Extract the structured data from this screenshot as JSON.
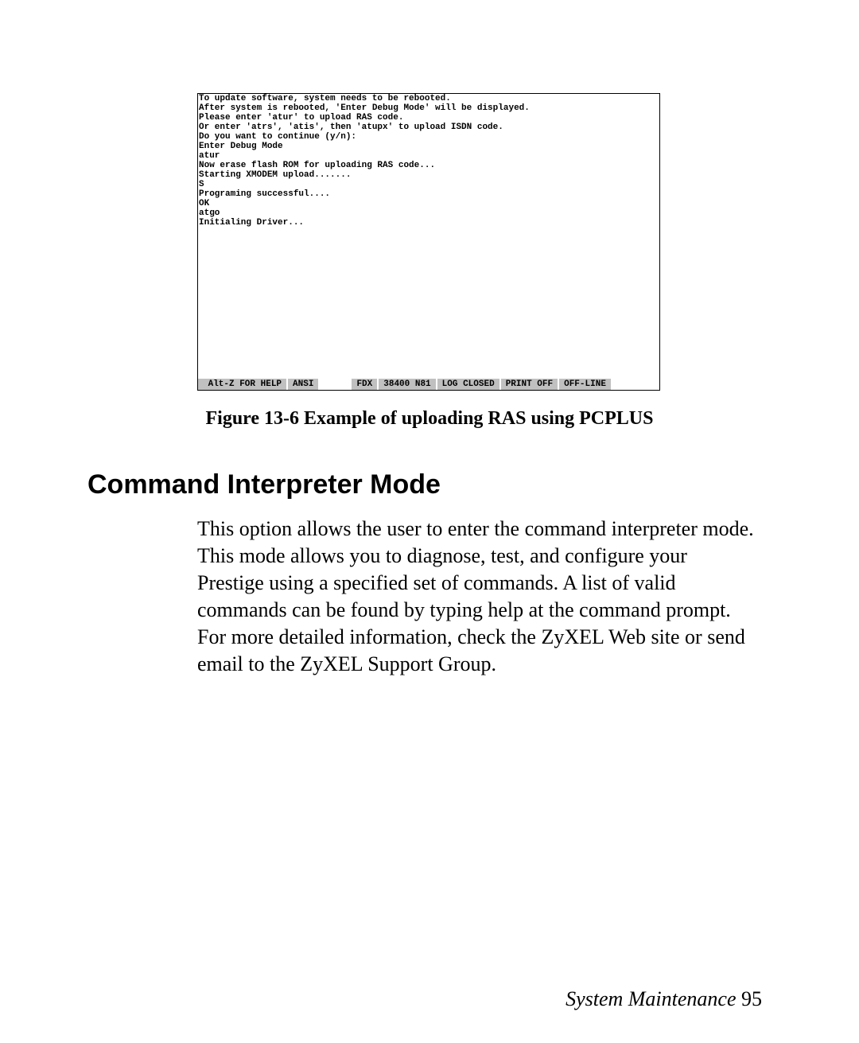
{
  "terminal": {
    "lines": [
      "To update software, system needs to be rebooted.",
      "After system is rebooted, 'Enter Debug Mode' will be displayed.",
      "Please enter 'atur' to upload RAS code.",
      "Or enter 'atrs', 'atis', then 'atupx' to upload ISDN code.",
      "Do you want to continue (y/n):",
      "Enter Debug Mode",
      "atur",
      "Now erase flash ROM for uploading RAS code...",
      "",
      "Starting XMODEM upload.......",
      "S",
      "Programing successful....",
      "",
      "OK",
      "atgo",
      "Initialing Driver..."
    ],
    "status": {
      "help": " Alt-Z FOR HELP",
      "emu": "ANSI",
      "duplex": "FDX",
      "port": "38400 N81",
      "log": "LOG CLOSED",
      "print": "PRINT OFF",
      "line": "OFF-LINE"
    }
  },
  "caption": "Figure 13-6 Example of uploading RAS using PCPLUS",
  "heading": "Command Interpreter Mode",
  "body": "This option allows the user to enter the command interpreter mode. This mode allows you to diagnose, test, and configure your Prestige using a specified set of commands. A list of valid commands can be found by typing help at the command prompt. For more detailed information, check the ZyXEL Web site or send email to the ZyXEL Support Group.",
  "footer": {
    "title": "System Maintenance  ",
    "page": "95"
  }
}
